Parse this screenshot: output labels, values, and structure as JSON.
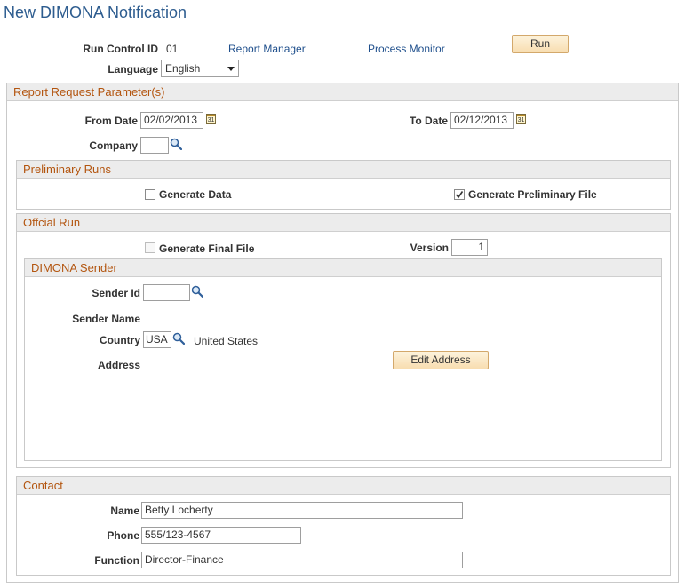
{
  "page": {
    "title": "New DIMONA Notification"
  },
  "run_control": {
    "label": "Run Control ID",
    "value": "01",
    "report_manager": "Report Manager",
    "process_monitor": "Process Monitor",
    "run_button": "Run",
    "language_label": "Language",
    "language_value": "English"
  },
  "params": {
    "header": "Report Request Parameter(s)",
    "from_date_label": "From Date",
    "from_date_value": "02/02/2013",
    "to_date_label": "To Date",
    "to_date_value": "02/12/2013",
    "company_label": "Company",
    "company_value": "",
    "calendar_glyph": "31"
  },
  "preliminary": {
    "header": "Preliminary Runs",
    "generate_data_label": "Generate Data",
    "generate_data_checked": false,
    "generate_preliminary_label": "Generate Preliminary File",
    "generate_preliminary_checked": true
  },
  "official": {
    "header": "Offcial Run",
    "generate_final_label": "Generate Final File",
    "generate_final_checked": false,
    "version_label": "Version",
    "version_value": "1"
  },
  "sender": {
    "header": "DIMONA Sender",
    "sender_id_label": "Sender Id",
    "sender_id_value": "",
    "sender_name_label": "Sender Name",
    "country_label": "Country",
    "country_value": "USA",
    "country_desc": "United States",
    "address_label": "Address",
    "edit_address_button": "Edit Address"
  },
  "contact": {
    "header": "Contact",
    "name_label": "Name",
    "name_value": "Betty Locherty",
    "phone_label": "Phone",
    "phone_value": "555/123-4567",
    "function_label": "Function",
    "function_value": "Director-Finance"
  },
  "icons": {
    "calendar": "calendar-icon",
    "lookup": "magnifier-lookup-icon",
    "dropdown": "chevron-down-icon",
    "checkmark": "checkmark-icon"
  },
  "colors": {
    "title": "#2d5c8f",
    "group_header_text": "#b3550f",
    "link": "#1f4f8c",
    "button_fill": "#f8ddb0"
  }
}
